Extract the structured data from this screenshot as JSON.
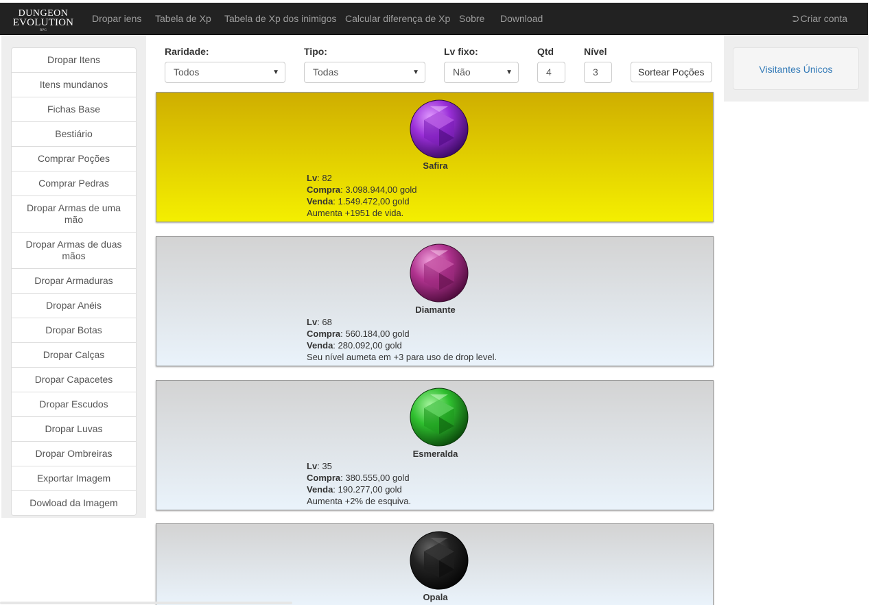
{
  "brand": {
    "line1": "DUNGEON",
    "line2": "EVOLUTION",
    "line3": "RPG"
  },
  "nav": {
    "items": [
      "Dropar iens",
      "Tabela de Xp",
      "Tabela de Xp dos inimigos",
      "Calcular diferença de Xp",
      "Sobre",
      "Download"
    ],
    "signin_icon": "sign-in-icon",
    "signin_label": "Criar conta"
  },
  "sidebar": {
    "items": [
      "Dropar Itens",
      "Itens mundanos",
      "Fichas Base",
      "Bestiário",
      "Comprar Poções",
      "Comprar Pedras",
      "Dropar Armas de uma mão",
      "Dropar Armas de duas mãos",
      "Dropar Armaduras",
      "Dropar Anéis",
      "Dropar Botas",
      "Dropar Calças",
      "Dropar Capacetes",
      "Dropar Escudos",
      "Dropar Luvas",
      "Dropar Ombreiras",
      "Exportar Imagem",
      "Dowload da Imagem"
    ]
  },
  "form": {
    "raridade": {
      "label": "Raridade:",
      "value": "Todos"
    },
    "tipo": {
      "label": "Tipo:",
      "value": "Todas"
    },
    "lvfixo": {
      "label": "Lv fixo:",
      "value": "Não"
    },
    "qtd": {
      "label": "Qtd",
      "value": "4"
    },
    "nivel": {
      "label": "Nível",
      "value": "3"
    },
    "button": "Sortear Poções"
  },
  "stat_labels": {
    "lv": "Lv",
    "compra": "Compra",
    "venda": "Venda"
  },
  "items": [
    {
      "name": "Safira",
      "lv": ": 82",
      "compra": ": 3.098.944,00 gold",
      "venda": ": 1.549.472,00 gold",
      "desc": "Aumenta +1951 de vida.",
      "color": "#8a2be2"
    },
    {
      "name": "Diamante",
      "lv": ": 68",
      "compra": ": 560.184,00 gold",
      "venda": ": 280.092,00 gold",
      "desc": "Seu nível aumeta em +3 para uso de drop level.",
      "color": "#b0338f"
    },
    {
      "name": "Esmeralda",
      "lv": ": 35",
      "compra": ": 380.555,00 gold",
      "venda": ": 190.277,00 gold",
      "desc": "Aumenta +2% de esquiva.",
      "color": "#2fbf2f"
    },
    {
      "name": "Opala",
      "color": "#1a1a1a"
    }
  ],
  "right_panel": {
    "visitors_label": "Visitantes Únicos"
  }
}
